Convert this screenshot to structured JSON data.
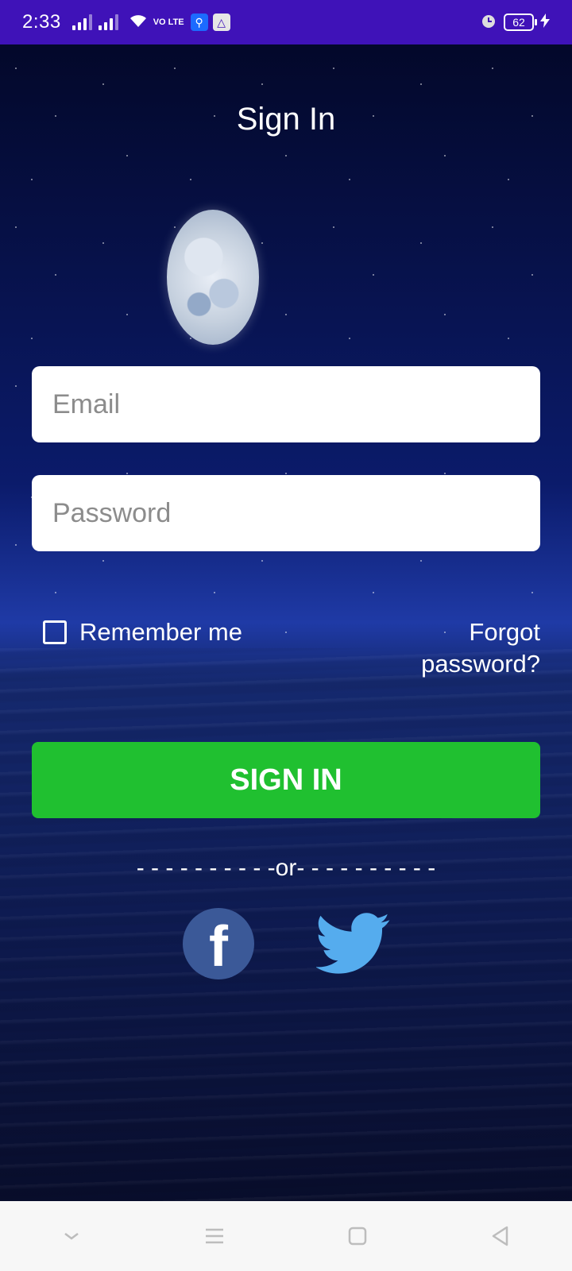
{
  "status_bar": {
    "time": "2:33",
    "lte_label": "VO LTE",
    "battery": "62"
  },
  "screen": {
    "title": "Sign In",
    "email_placeholder": "Email",
    "password_placeholder": "Password",
    "remember_label": "Remember me",
    "forgot_label": "Forgot password?",
    "signin_label": "SIGN IN",
    "or_text": "- - - - - - - - - -or- - - - - - - - - -",
    "facebook_glyph": "f"
  },
  "colors": {
    "status_bar": "#3f12b8",
    "signin_button": "#20c030",
    "facebook": "#3b5998",
    "twitter": "#55acee"
  }
}
